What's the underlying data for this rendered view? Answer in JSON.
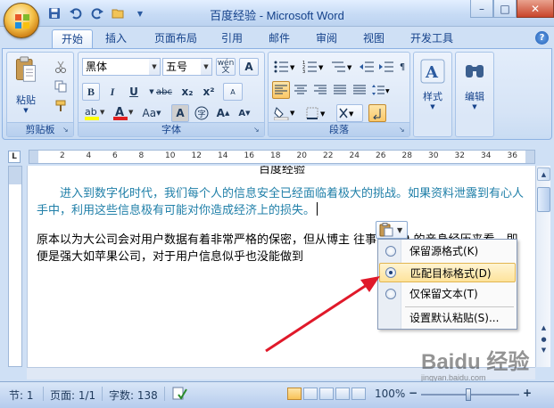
{
  "window": {
    "title": "百度经验 - Microsoft Word",
    "minimize": "–",
    "maximize": "□",
    "close": "✕"
  },
  "quick_access": {
    "icons": [
      "save-icon",
      "undo-icon",
      "redo-icon",
      "open-icon"
    ]
  },
  "tabs": [
    {
      "label": "开始",
      "active": true
    },
    {
      "label": "插入"
    },
    {
      "label": "页面布局"
    },
    {
      "label": "引用"
    },
    {
      "label": "邮件"
    },
    {
      "label": "审阅"
    },
    {
      "label": "视图"
    },
    {
      "label": "开发工具"
    }
  ],
  "ribbon": {
    "clipboard": {
      "label": "剪贴板",
      "paste": "粘贴"
    },
    "font": {
      "label": "字体",
      "font_name": "黑体",
      "font_size": "五号",
      "wen": "wén",
      "bold": "B",
      "italic": "I",
      "underline": "U",
      "strike": "abc",
      "subscript": "x₂",
      "superscript": "x²",
      "case": "Aa",
      "grow": "A",
      "shrink": "A",
      "clear": "A"
    },
    "paragraph": {
      "label": "段落"
    },
    "styles": {
      "label": "样式"
    },
    "editing": {
      "label": "编辑"
    }
  },
  "ruler": {
    "corner": "L",
    "numbers": [
      "2",
      "4",
      "6",
      "8",
      "10",
      "12",
      "14",
      "16",
      "18",
      "20",
      "22",
      "24",
      "26",
      "28",
      "30",
      "32",
      "34",
      "36"
    ]
  },
  "document": {
    "title_fragment": "百度经验",
    "paragraph1": "进入到数字化时代，我们每个人的信息安全已经面临着极大的挑战。如果资料泄露到有心人手中，利用这些信息极有可能对你造成经济上的损失。",
    "paragraph2": "原本以为大公司会对用户数据有着非常严格的保密，但从博主 往事 1999 的亲身经历来看，即便是强大如苹果公司，对于用户信息似乎也没能做到"
  },
  "paste_options": {
    "items": [
      {
        "label": "保留源格式(K)",
        "selected": false
      },
      {
        "label": "匹配目标格式(D)",
        "selected": true
      },
      {
        "label": "仅保留文本(T)",
        "selected": false
      }
    ],
    "default": "设置默认粘贴(S)..."
  },
  "status": {
    "page": "节: 1",
    "pages": "页面: 1/1",
    "words": "字数: 138",
    "zoom": "100%",
    "zoom_value": 100
  },
  "watermark": {
    "brand": "Baidu 经验",
    "url": "jingyan.baidu.com"
  },
  "colors": {
    "accent": "#15428b",
    "doc_blue": "#1f7fa8",
    "arrow": "#e0192a"
  }
}
